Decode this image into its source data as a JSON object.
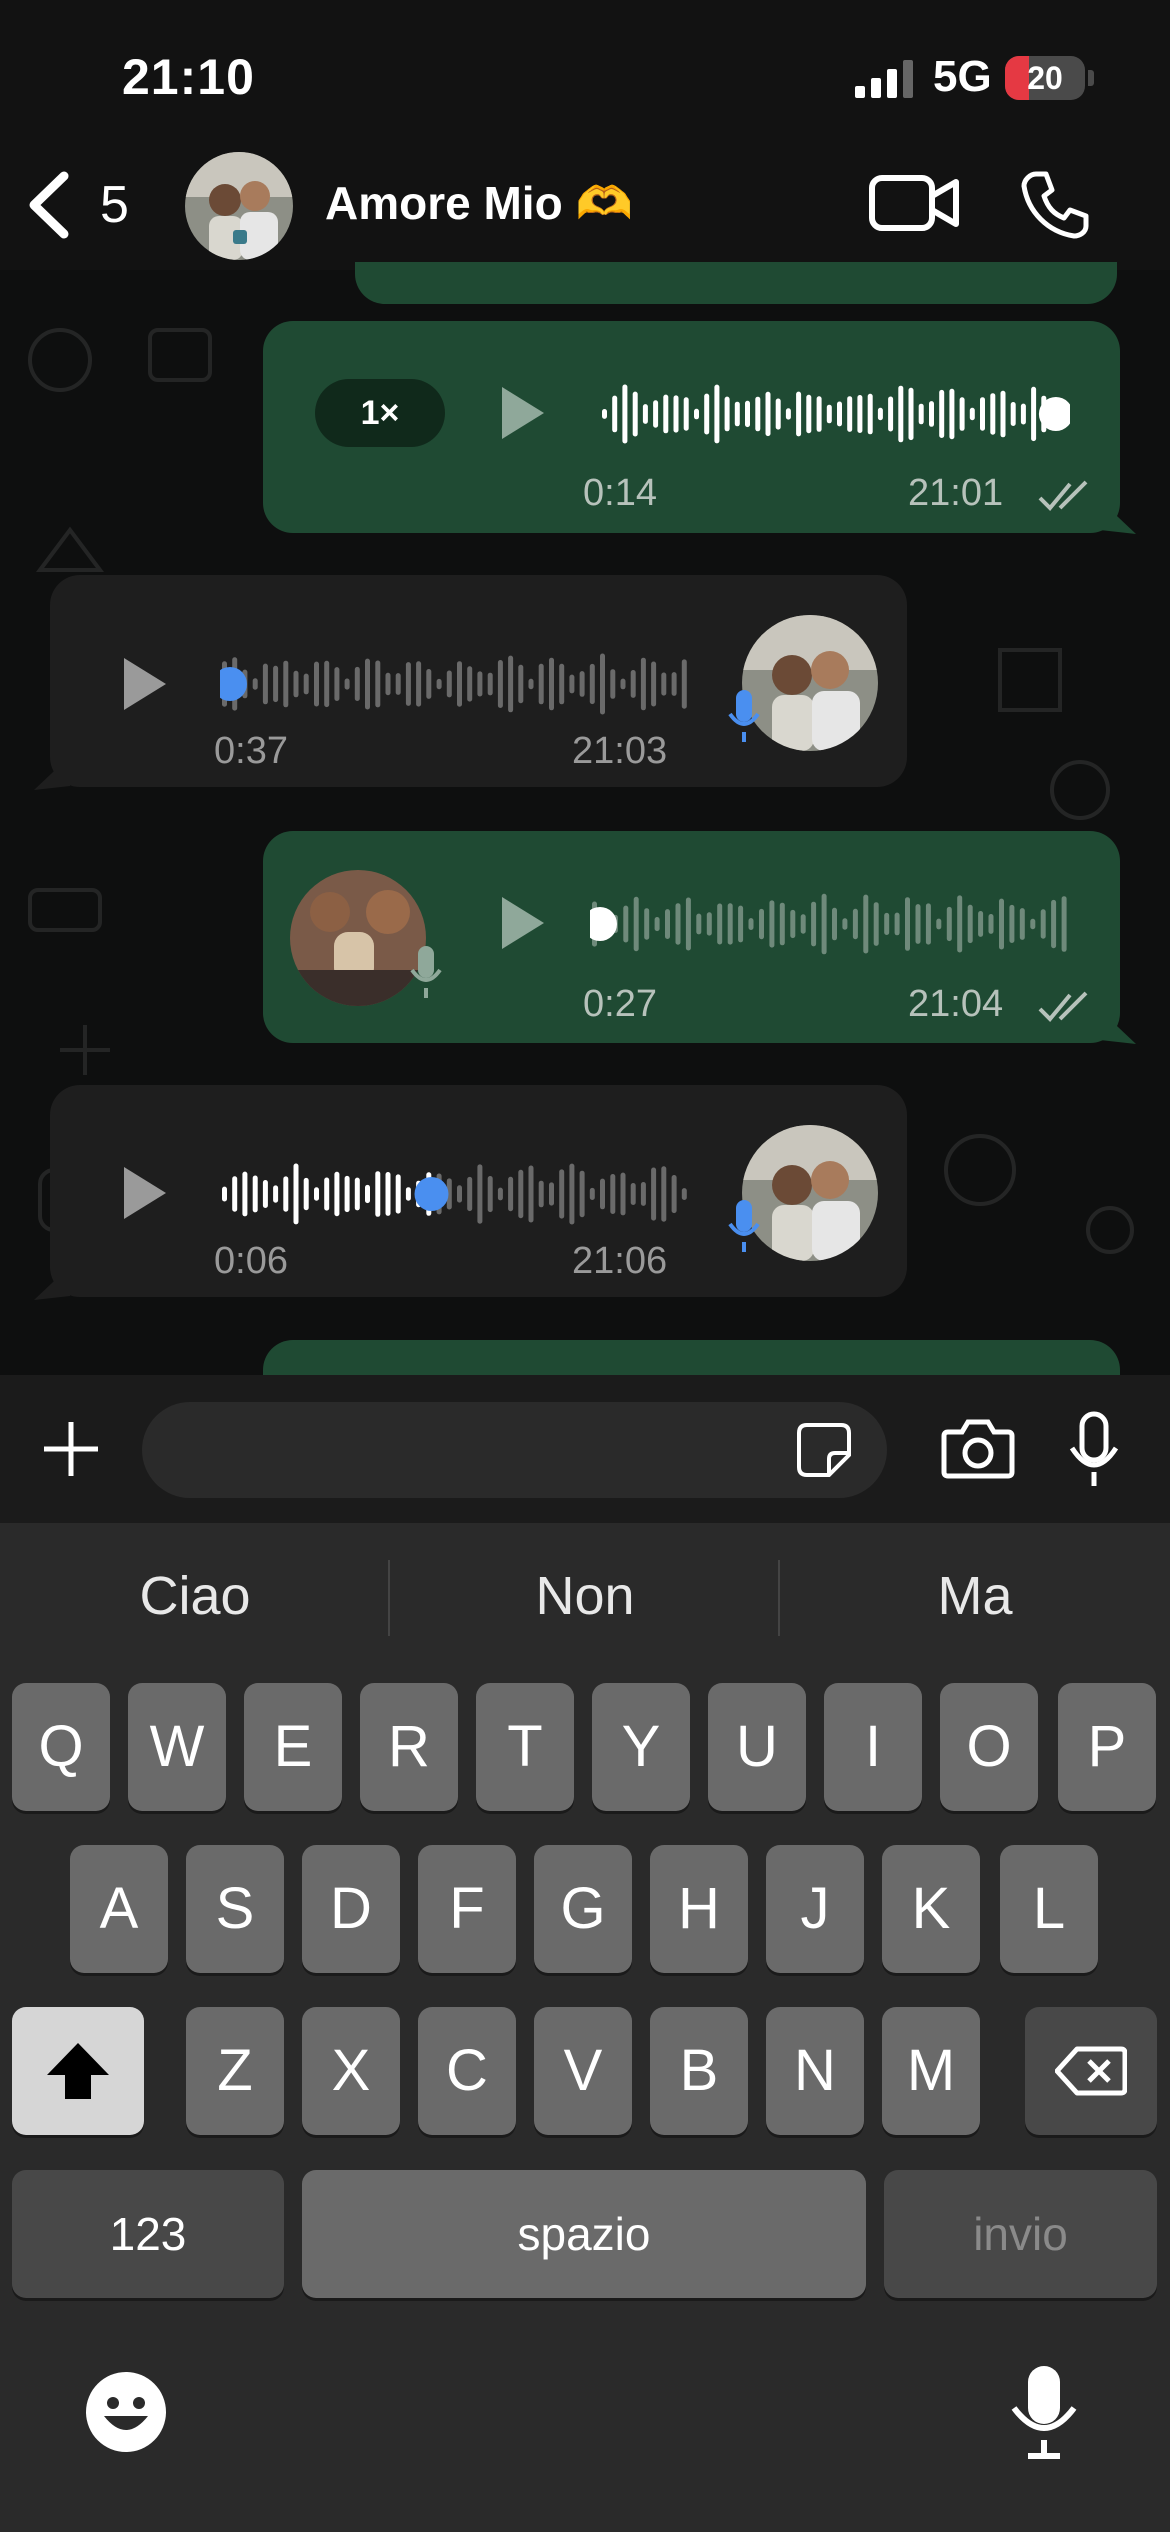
{
  "status": {
    "time": "21:10",
    "network": "5G",
    "battery": "20"
  },
  "header": {
    "back_count": "5",
    "contact_name": "Amore Mio 🫶"
  },
  "messages": [
    {
      "direction": "out",
      "speed": "1×",
      "duration": "0:14",
      "time": "21:01",
      "progress": 0.97
    },
    {
      "direction": "in",
      "duration": "0:37",
      "time": "21:03",
      "progress": 0.0
    },
    {
      "direction": "out",
      "duration": "0:27",
      "time": "21:04",
      "progress": 0.0
    },
    {
      "direction": "in",
      "duration": "0:06",
      "time": "21:06",
      "progress": 0.45
    }
  ],
  "composer": {
    "placeholder": ""
  },
  "keyboard": {
    "suggestions": [
      "Ciao",
      "Non",
      "Ma"
    ],
    "row1": [
      "Q",
      "W",
      "E",
      "R",
      "T",
      "Y",
      "U",
      "I",
      "O",
      "P"
    ],
    "row2": [
      "A",
      "S",
      "D",
      "F",
      "G",
      "H",
      "J",
      "K",
      "L"
    ],
    "row3": [
      "Z",
      "X",
      "C",
      "V",
      "B",
      "N",
      "M"
    ],
    "numbers_label": "123",
    "space_label": "spazio",
    "return_label": "invio"
  },
  "colors": {
    "accent_blue": "#4a8ff0",
    "bubble_out": "#1f4a33",
    "bubble_in": "#1e1e1e",
    "battery_low": "#e53943"
  }
}
